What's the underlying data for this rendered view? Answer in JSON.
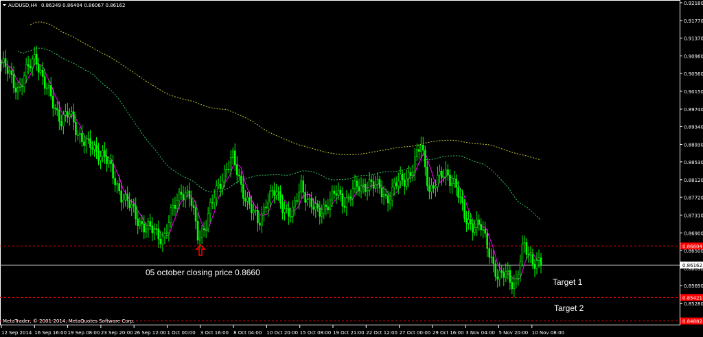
{
  "header": {
    "symbol": "AUDUSD,H4",
    "ohlc": "0.86349 0.86404 0.86067 0.86162"
  },
  "footer": {
    "copyright": "MetaTrader, © 2001-2014, MetaQuotes Software Corp."
  },
  "colors": {
    "background": "#000000",
    "candle": "#00ff00",
    "ma_fast": "#ff00ff",
    "ma_mid": "#33cc66",
    "ma_slow": "#cccc33",
    "level_line": "#ff0000",
    "price_line": "#c0c0c0",
    "price_label_bg": "#ffffff",
    "level_label_bg": "#ff0000"
  },
  "chart_data": {
    "type": "candlestick",
    "symbol": "AUDUSD",
    "timeframe": "H4",
    "ylim": [
      0.8478,
      0.9218
    ],
    "y_ticks": [
      "0.92180",
      "0.91770",
      "0.91370",
      "0.90960",
      "0.90560",
      "0.90150",
      "0.89740",
      "0.89340",
      "0.88930",
      "0.88530",
      "0.88120",
      "0.87720",
      "0.87310",
      "0.86900",
      "0.86500",
      "0.86090",
      "0.85690",
      "0.85280",
      "0.84880"
    ],
    "x_ticks": [
      "12 Sep 2014",
      "16 Sep 16:00",
      "19 Sep 08:00",
      "23 Sep 20:00",
      "26 Sep 12:00",
      "1 Oct 00:00",
      "3 Oct 16:00",
      "8 Oct 04:00",
      "10 Oct 20:00",
      "15 Oct 08:00",
      "19 Oct 21:00",
      "22 Oct 12:00",
      "27 Oct 00:00",
      "29 Oct 16:00",
      "3 Nov 04:00",
      "5 Nov 20:00",
      "10 Nov 08:00"
    ],
    "current_price": "0.86162",
    "horizontal_levels": [
      {
        "price": 0.866,
        "label": "0.86604"
      },
      {
        "price": 0.8542,
        "label": "0.85421"
      },
      {
        "price": 0.8488,
        "label": "0.84882"
      }
    ],
    "close_path": [
      0.908,
      0.905,
      0.902,
      0.906,
      0.91,
      0.903,
      0.899,
      0.895,
      0.896,
      0.892,
      0.889,
      0.888,
      0.887,
      0.882,
      0.878,
      0.875,
      0.872,
      0.87,
      0.869,
      0.868,
      0.874,
      0.879,
      0.877,
      0.868,
      0.872,
      0.878,
      0.883,
      0.886,
      0.88,
      0.875,
      0.871,
      0.877,
      0.878,
      0.875,
      0.873,
      0.88,
      0.876,
      0.873,
      0.876,
      0.878,
      0.876,
      0.879,
      0.879,
      0.881,
      0.879,
      0.877,
      0.88,
      0.881,
      0.884,
      0.889,
      0.879,
      0.881,
      0.883,
      0.88,
      0.873,
      0.871,
      0.87,
      0.865,
      0.858,
      0.86,
      0.857,
      0.866,
      0.863,
      0.8616
    ],
    "annotations": [
      {
        "text": "05 october closing price 0.8660"
      },
      {
        "text": "Target 1"
      },
      {
        "text": "Target 2"
      }
    ],
    "grid": false
  }
}
